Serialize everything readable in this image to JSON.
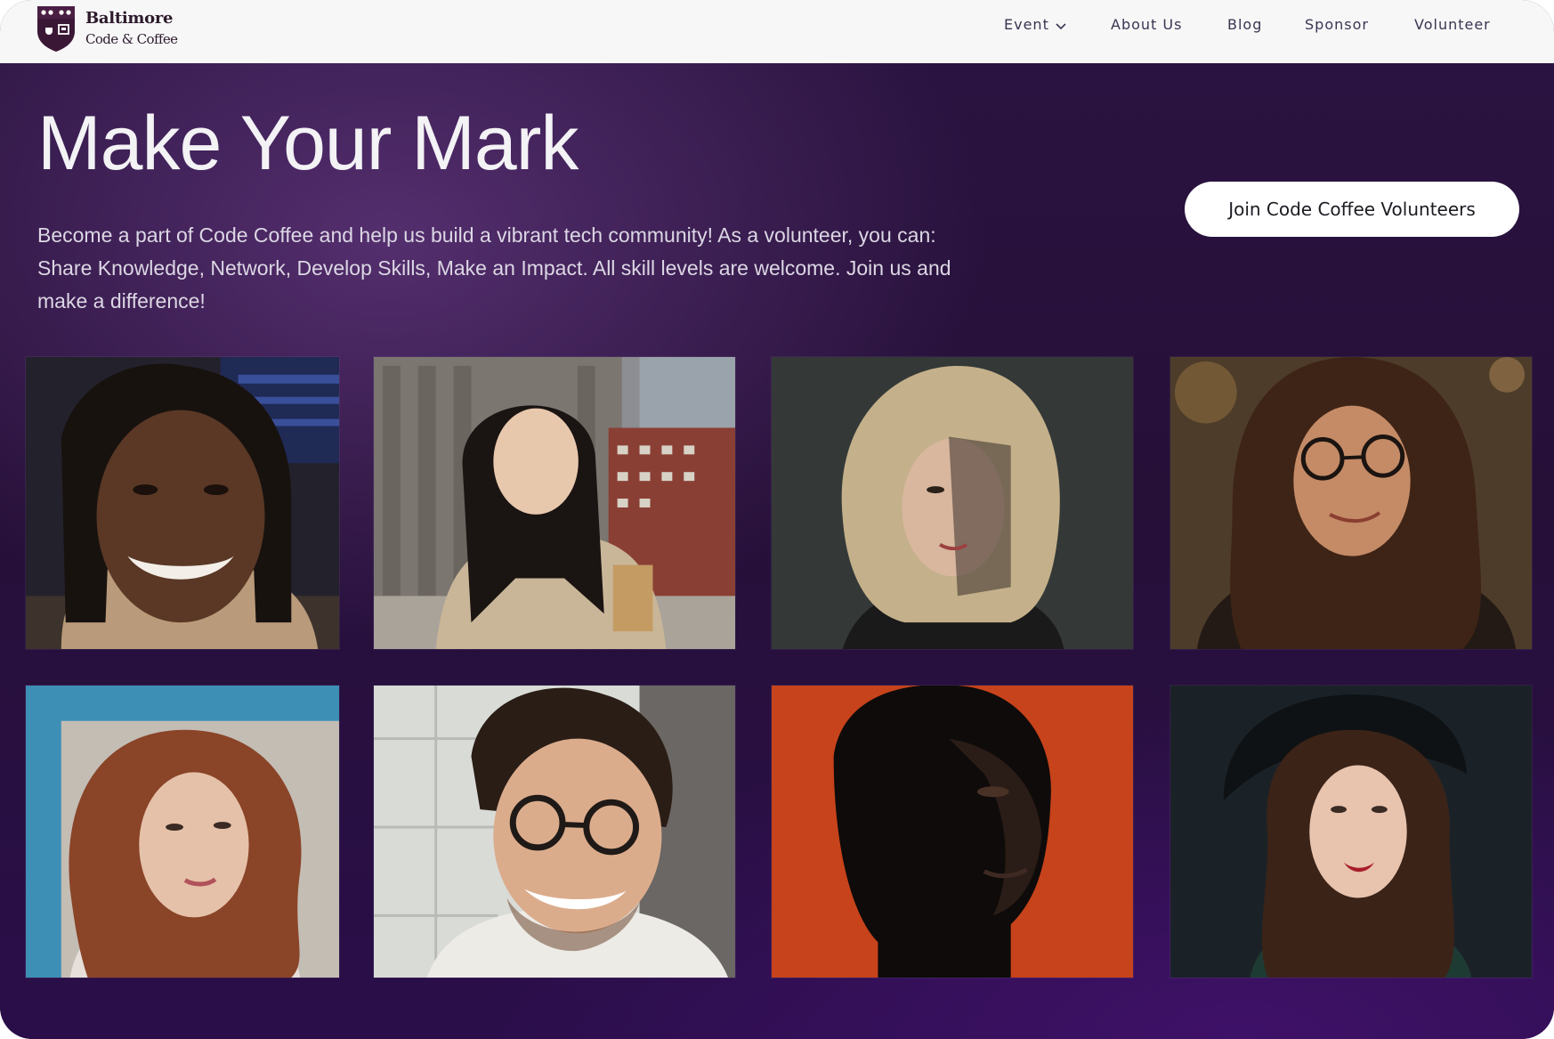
{
  "brand": {
    "name_line1": "Baltimore",
    "name_line2": "Code & Coffee",
    "logo_icon": "shield-crest-icon",
    "colors": {
      "shield": "#3b1736",
      "accent": "#ffffff"
    }
  },
  "nav": {
    "items": [
      {
        "label": "Event",
        "has_dropdown": true
      },
      {
        "label": "About Us"
      },
      {
        "label": "Blog"
      },
      {
        "label": "Sponsor"
      },
      {
        "label": "Volunteer"
      }
    ]
  },
  "hero": {
    "title": "Make Your Mark",
    "description": "Become a part of Code Coffee and help us build a vibrant tech community! As a volunteer, you can: Share Knowledge,  Network,  Develop Skills,  Make an Impact. All skill levels are welcome. Join us and make a difference!",
    "cta_label": "Join Code Coffee Volunteers",
    "background_color": "#261038"
  },
  "gallery": {
    "photos": [
      {
        "subject": "smiling man with locs",
        "bg": "#2c2a36"
      },
      {
        "subject": "woman holding coffee cup in city",
        "bg": "#8a8076"
      },
      {
        "subject": "woman with blonde wavy hair",
        "bg": "#3a3d3b"
      },
      {
        "subject": "woman with glasses and long hair",
        "bg": "#4a3a2a"
      },
      {
        "subject": "woman with red hair",
        "bg": "#c6c2bc"
      },
      {
        "subject": "smiling man with glasses",
        "bg": "#d8dad6"
      },
      {
        "subject": "man on orange background",
        "bg": "#c8441c"
      },
      {
        "subject": "woman with hat and red lipstick",
        "bg": "#1c2328"
      }
    ]
  }
}
